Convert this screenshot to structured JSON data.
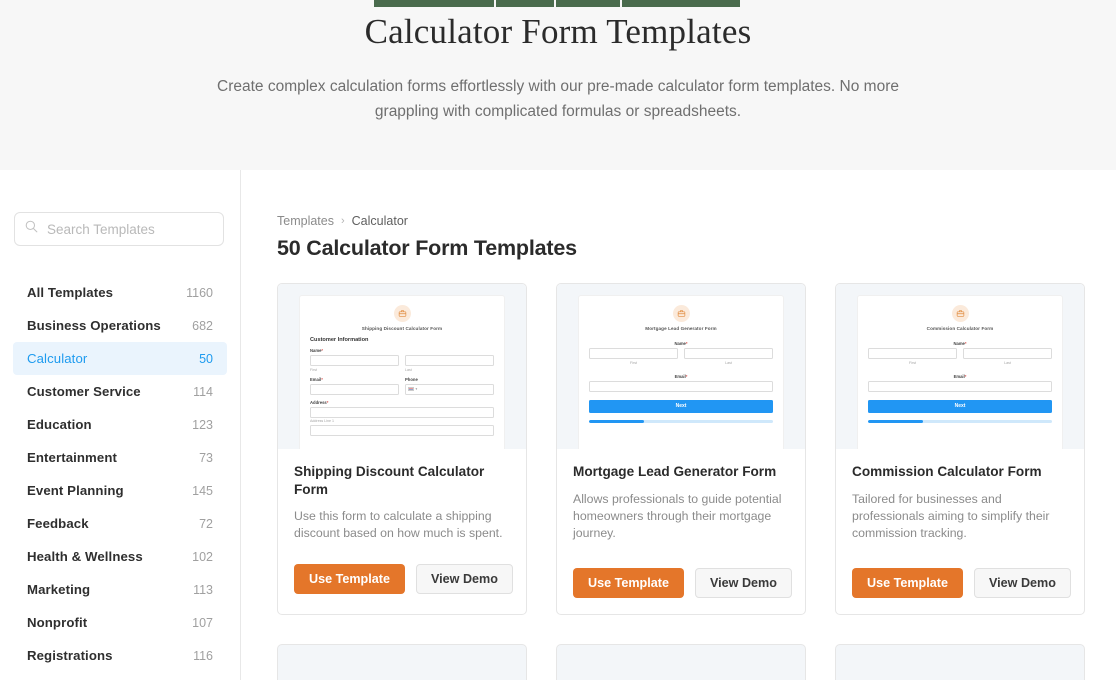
{
  "hero": {
    "title": "Calculator Form Templates",
    "subtitle": "Create complex calculation forms effortlessly with our pre-made calculator form templates. No more grappling with complicated formulas or spreadsheets.",
    "nav_accent_color": "#4a6b4d",
    "background_color": "#f7f7f7"
  },
  "sidebar": {
    "search": {
      "placeholder": "Search Templates",
      "value": "",
      "icon": "search-icon"
    },
    "items": [
      {
        "label": "All Templates",
        "count": "1160",
        "active": false
      },
      {
        "label": "Business Operations",
        "count": "682",
        "active": false
      },
      {
        "label": "Calculator",
        "count": "50",
        "active": true
      },
      {
        "label": "Customer Service",
        "count": "114",
        "active": false
      },
      {
        "label": "Education",
        "count": "123",
        "active": false
      },
      {
        "label": "Entertainment",
        "count": "73",
        "active": false
      },
      {
        "label": "Event Planning",
        "count": "145",
        "active": false
      },
      {
        "label": "Feedback",
        "count": "72",
        "active": false
      },
      {
        "label": "Health & Wellness",
        "count": "102",
        "active": false
      },
      {
        "label": "Marketing",
        "count": "113",
        "active": false
      },
      {
        "label": "Nonprofit",
        "count": "107",
        "active": false
      },
      {
        "label": "Registrations",
        "count": "116",
        "active": false
      }
    ],
    "active_color": "#1e9bef",
    "active_background": "#eaf4fd"
  },
  "main": {
    "breadcrumb": {
      "root": "Templates",
      "separator": "›",
      "current": "Calculator"
    },
    "title": "50 Calculator Form Templates",
    "buttons": {
      "primary": "Use Template",
      "secondary": "View Demo"
    },
    "primary_color": "#e4762a",
    "cards": [
      {
        "title": "Shipping Discount Calculator Form",
        "description": "Use this form to calculate a shipping discount based on how much is spent.",
        "preview": {
          "layout": "left",
          "form_title": "Shipping Discount Calculator Form",
          "section": "Customer Information",
          "fields": [
            {
              "label": "Name",
              "required": true,
              "sub_left": "First",
              "sub_right": "Last",
              "split": true
            },
            {
              "label_left": "Email",
              "label_right": "Phone",
              "required": true,
              "phone": true,
              "pair": true
            },
            {
              "label": "Address",
              "required": true,
              "sub_left": "Address Line 1"
            }
          ]
        }
      },
      {
        "title": "Mortgage Lead Generator Form",
        "description": "Allows professionals to guide potential homeowners through their mortgage journey.",
        "preview": {
          "layout": "center",
          "form_title": "Mortgage Lead Generator Form",
          "fields": [
            {
              "label": "Name",
              "required": true,
              "sub_left": "First",
              "sub_right": "Last",
              "split": true
            },
            {
              "label": "Email",
              "required": true
            }
          ],
          "next_label": "Next",
          "progress_percent": 30
        }
      },
      {
        "title": "Commission Calculator Form",
        "description": "Tailored for businesses and professionals aiming to simplify their commission tracking.",
        "preview": {
          "layout": "center",
          "form_title": "Commission Calculator Form",
          "fields": [
            {
              "label": "Name",
              "required": true,
              "sub_left": "First",
              "sub_right": "Last",
              "split": true
            },
            {
              "label": "Email",
              "required": true
            }
          ],
          "next_label": "Next",
          "progress_percent": 30
        }
      }
    ]
  }
}
